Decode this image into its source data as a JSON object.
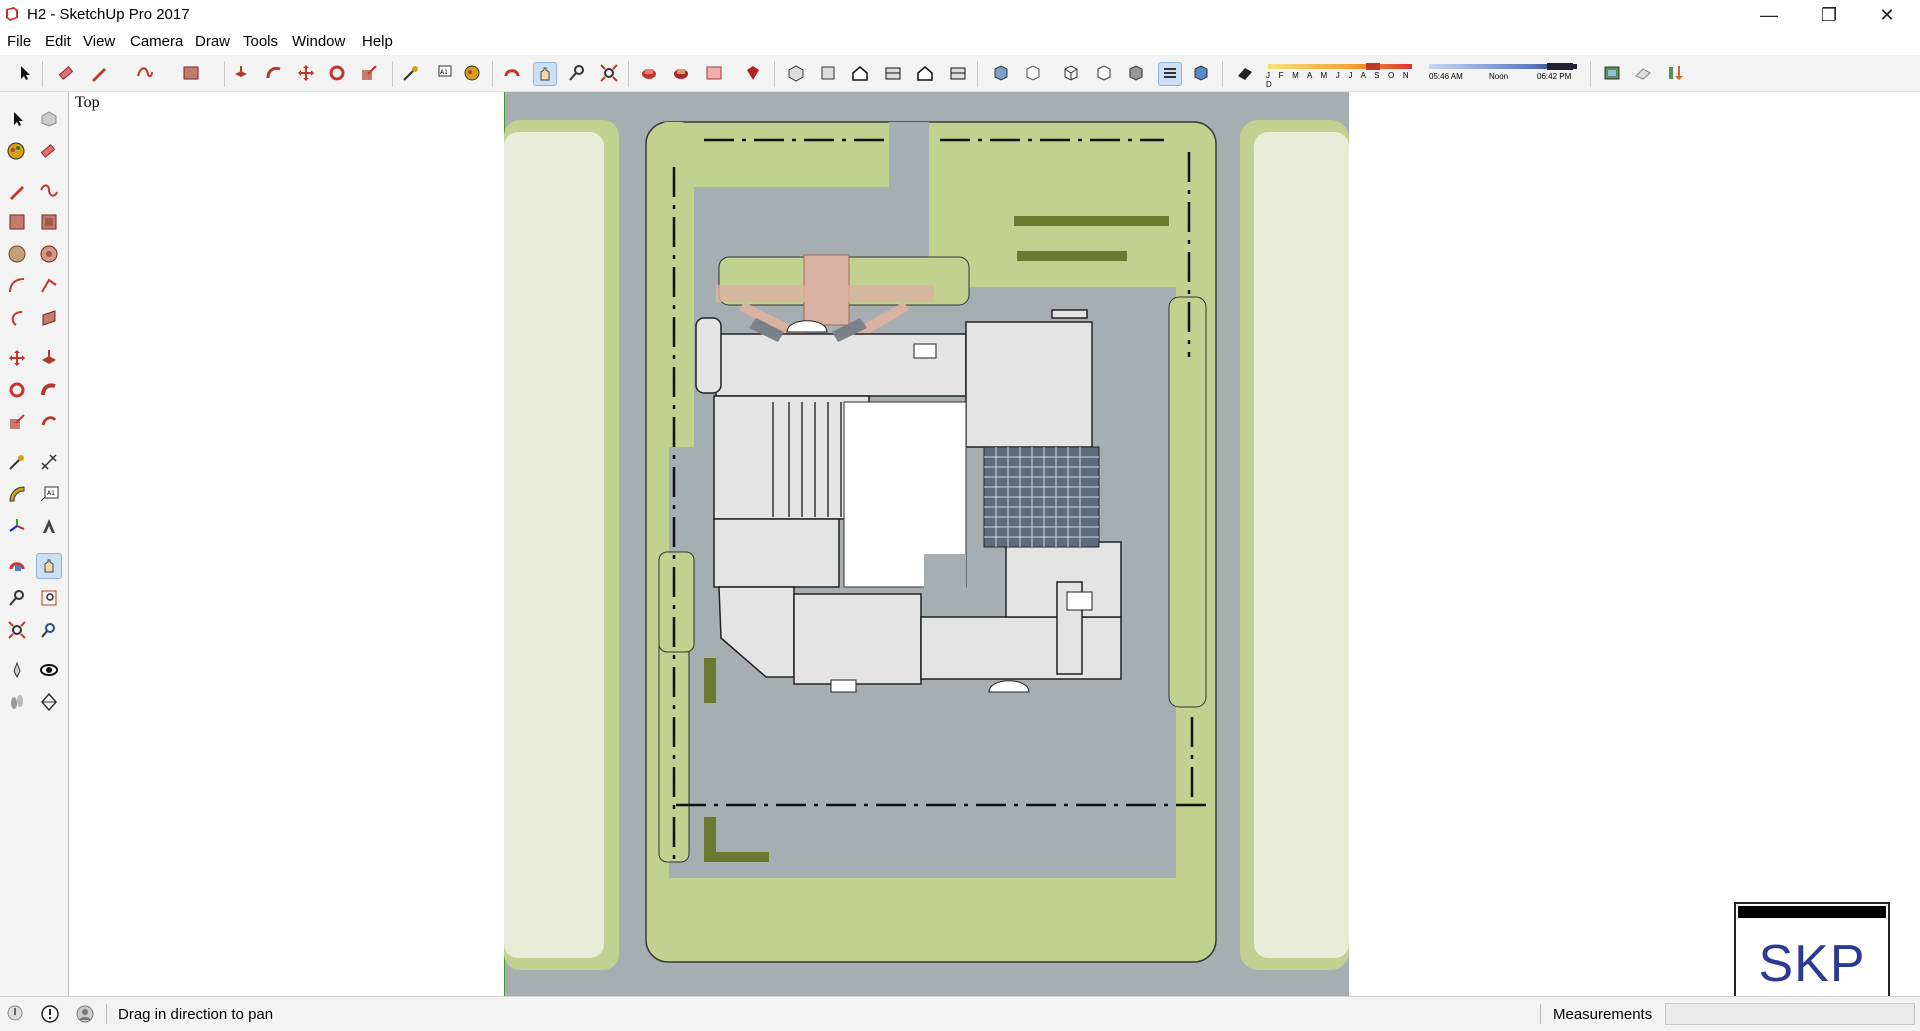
{
  "window": {
    "title": "H2 - SketchUp Pro 2017",
    "minimize_glyph": "—",
    "restore_glyph": "❐",
    "close_glyph": "✕"
  },
  "menu": [
    "File",
    "Edit",
    "View",
    "Camera",
    "Draw",
    "Tools",
    "Window",
    "Help"
  ],
  "toolbar_icons": [
    "select-tool-icon",
    "eraser-icon",
    "pencil-line-icon",
    "freehand-icon",
    "rectangle-icon",
    "push-pull-icon",
    "follow-me-icon",
    "move-icon",
    "rotate-icon",
    "scale-icon",
    "tape-measure-icon",
    "text-icon",
    "paint-bucket-icon",
    "orbit-icon",
    "pan-icon",
    "zoom-icon",
    "zoom-extents-icon",
    "3d-warehouse-icon",
    "extension-warehouse-icon",
    "layout-icon",
    "ruby-icon",
    "iso-view-icon",
    "top-view-icon",
    "front-view-icon",
    "right-view-icon",
    "back-view-icon",
    "left-view-icon",
    "xray-icon",
    "back-edges-icon",
    "wireframe-icon",
    "hidden-line-icon",
    "shaded-icon",
    "shaded-textures-icon",
    "shadows-toggle-icon"
  ],
  "shadow_settings": {
    "months": "J F M A M J J A S O N D",
    "time_start": "05:46 AM",
    "time_mid": "Noon",
    "time_end": "06:42 PM"
  },
  "left_tools": [
    [
      "select-icon",
      "component-icon"
    ],
    [
      "paint-icon",
      "eraser-icon"
    ],
    [
      "line-icon",
      "freehand-icon"
    ],
    [
      "rectangle-icon",
      "rotated-rectangle-icon"
    ],
    [
      "circle-icon",
      "polygon-icon"
    ],
    [
      "arc-icon",
      "two-point-arc-icon"
    ],
    [
      "three-point-arc-icon",
      "pie-icon"
    ],
    [
      "move-icon",
      "push-pull-icon"
    ],
    [
      "rotate-icon",
      "follow-me-icon"
    ],
    [
      "scale-icon",
      "offset-icon"
    ],
    [
      "tape-measure-icon",
      "dimension-icon"
    ],
    [
      "protractor-icon",
      "text-icon"
    ],
    [
      "axes-icon",
      "3d-text-icon"
    ],
    [
      "orbit-icon",
      "pan-icon"
    ],
    [
      "zoom-icon",
      "zoom-window-icon"
    ],
    [
      "zoom-extents-icon",
      "previous-view-icon"
    ],
    [
      "position-camera-icon",
      "look-around-icon"
    ],
    [
      "walk-icon",
      "section-plane-icon"
    ]
  ],
  "viewport": {
    "view_name": "Top",
    "model_colors": {
      "road": "#a7aeb1",
      "grass": "#c2d18f",
      "building": "#e4e4e4",
      "paving": "#d9b2a2"
    }
  },
  "status": {
    "message": "Drag in direction to pan",
    "measurements_label": "Measurements",
    "measurements_value": ""
  },
  "watermark": {
    "text": "SKP"
  },
  "accent_color": "#cce0f5"
}
